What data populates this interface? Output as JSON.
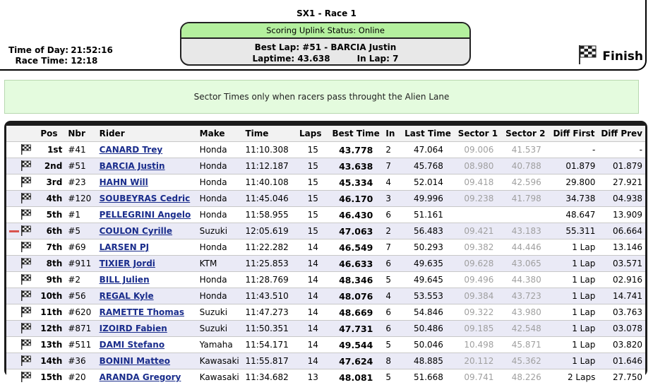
{
  "race": {
    "title": "SX1 - Race 1"
  },
  "status": {
    "uplink": "Scoring Uplink Status: Online",
    "best_lap": "Best Lap: #51 - BARCIA Justin",
    "laptime": "Laptime: 43.638",
    "in_lap": "In Lap: 7"
  },
  "clock": {
    "time_of_day_label": "Time of Day:",
    "time_of_day": "21:52:16",
    "race_time_label": "Race Time:",
    "race_time": "12:18"
  },
  "flag": {
    "label": "Finish",
    "icon": "checkered-flag-icon"
  },
  "sector_note": "Sector Times only when racers pass throught the Alien Lane",
  "columns": [
    "Pos",
    "Nbr",
    "Rider",
    "Make",
    "Time",
    "Laps",
    "Best Time",
    "In",
    "Last Time",
    "Sector 1",
    "Sector 2",
    "Diff First",
    "Diff Prev"
  ],
  "rows": [
    {
      "pos": "1st",
      "nbr": "#41",
      "rider": "CANARD Trey",
      "make": "Honda",
      "time": "11:10.308",
      "laps": "15",
      "best": "43.778",
      "in": "2",
      "last": "47.064",
      "s1": "09.006",
      "s2": "41.537",
      "dfirst": "-",
      "dprev": "-",
      "marker": false
    },
    {
      "pos": "2nd",
      "nbr": "#51",
      "rider": "BARCIA Justin",
      "make": "Honda",
      "time": "11:12.187",
      "laps": "15",
      "best": "43.638",
      "in": "7",
      "last": "45.768",
      "s1": "08.980",
      "s2": "40.788",
      "dfirst": "01.879",
      "dprev": "01.879",
      "marker": false
    },
    {
      "pos": "3rd",
      "nbr": "#23",
      "rider": "HAHN Will",
      "make": "Honda",
      "time": "11:40.108",
      "laps": "15",
      "best": "45.334",
      "in": "4",
      "last": "52.014",
      "s1": "09.418",
      "s2": "42.596",
      "dfirst": "29.800",
      "dprev": "27.921",
      "marker": false
    },
    {
      "pos": "4th",
      "nbr": "#120",
      "rider": "SOUBEYRAS Cedric",
      "make": "Honda",
      "time": "11:45.046",
      "laps": "15",
      "best": "46.170",
      "in": "3",
      "last": "49.996",
      "s1": "09.238",
      "s2": "41.798",
      "dfirst": "34.738",
      "dprev": "04.938",
      "marker": false
    },
    {
      "pos": "5th",
      "nbr": "#1",
      "rider": "PELLEGRINI Angelo",
      "make": "Honda",
      "time": "11:58.955",
      "laps": "15",
      "best": "46.430",
      "in": "6",
      "last": "51.161",
      "s1": "",
      "s2": "",
      "dfirst": "48.647",
      "dprev": "13.909",
      "marker": false
    },
    {
      "pos": "6th",
      "nbr": "#5",
      "rider": "COULON Cyrille",
      "make": "Suzuki",
      "time": "12:05.619",
      "laps": "15",
      "best": "47.063",
      "in": "2",
      "last": "56.483",
      "s1": "09.421",
      "s2": "43.183",
      "dfirst": "55.311",
      "dprev": "06.664",
      "marker": true
    },
    {
      "pos": "7th",
      "nbr": "#69",
      "rider": "LARSEN PJ",
      "make": "Honda",
      "time": "11:22.282",
      "laps": "14",
      "best": "46.549",
      "in": "7",
      "last": "50.293",
      "s1": "09.382",
      "s2": "44.446",
      "dfirst": "1 Lap",
      "dprev": "13.146",
      "marker": false
    },
    {
      "pos": "8th",
      "nbr": "#911",
      "rider": "TIXIER Jordi",
      "make": "KTM",
      "time": "11:25.853",
      "laps": "14",
      "best": "46.633",
      "in": "6",
      "last": "49.635",
      "s1": "09.628",
      "s2": "43.065",
      "dfirst": "1 Lap",
      "dprev": "03.571",
      "marker": false
    },
    {
      "pos": "9th",
      "nbr": "#2",
      "rider": "BILL Julien",
      "make": "Honda",
      "time": "11:28.769",
      "laps": "14",
      "best": "48.346",
      "in": "5",
      "last": "49.645",
      "s1": "09.496",
      "s2": "44.380",
      "dfirst": "1 Lap",
      "dprev": "02.916",
      "marker": false
    },
    {
      "pos": "10th",
      "nbr": "#56",
      "rider": "REGAL Kyle",
      "make": "Honda",
      "time": "11:43.510",
      "laps": "14",
      "best": "48.076",
      "in": "4",
      "last": "53.553",
      "s1": "09.384",
      "s2": "43.723",
      "dfirst": "1 Lap",
      "dprev": "14.741",
      "marker": false
    },
    {
      "pos": "11th",
      "nbr": "#620",
      "rider": "RAMETTE Thomas",
      "make": "Suzuki",
      "time": "11:47.273",
      "laps": "14",
      "best": "48.669",
      "in": "6",
      "last": "54.846",
      "s1": "09.322",
      "s2": "43.980",
      "dfirst": "1 Lap",
      "dprev": "03.763",
      "marker": false
    },
    {
      "pos": "12th",
      "nbr": "#871",
      "rider": "IZOIRD Fabien",
      "make": "Suzuki",
      "time": "11:50.351",
      "laps": "14",
      "best": "47.731",
      "in": "6",
      "last": "50.486",
      "s1": "09.185",
      "s2": "42.548",
      "dfirst": "1 Lap",
      "dprev": "03.078",
      "marker": false
    },
    {
      "pos": "13th",
      "nbr": "#511",
      "rider": "DAMI Stefano",
      "make": "Yamaha",
      "time": "11:54.171",
      "laps": "14",
      "best": "49.544",
      "in": "5",
      "last": "50.046",
      "s1": "10.498",
      "s2": "45.871",
      "dfirst": "1 Lap",
      "dprev": "03.820",
      "marker": false
    },
    {
      "pos": "14th",
      "nbr": "#36",
      "rider": "BONINI Matteo",
      "make": "Kawasaki",
      "time": "11:55.817",
      "laps": "14",
      "best": "47.624",
      "in": "8",
      "last": "48.885",
      "s1": "20.112",
      "s2": "45.362",
      "dfirst": "1 Lap",
      "dprev": "01.646",
      "marker": false
    },
    {
      "pos": "15th",
      "nbr": "#20",
      "rider": "ARANDA Gregory",
      "make": "Kawasaki",
      "time": "11:34.682",
      "laps": "13",
      "best": "48.081",
      "in": "5",
      "last": "51.668",
      "s1": "09.741",
      "s2": "48.226",
      "dfirst": "2 Laps",
      "dprev": "27.750",
      "marker": false
    }
  ]
}
